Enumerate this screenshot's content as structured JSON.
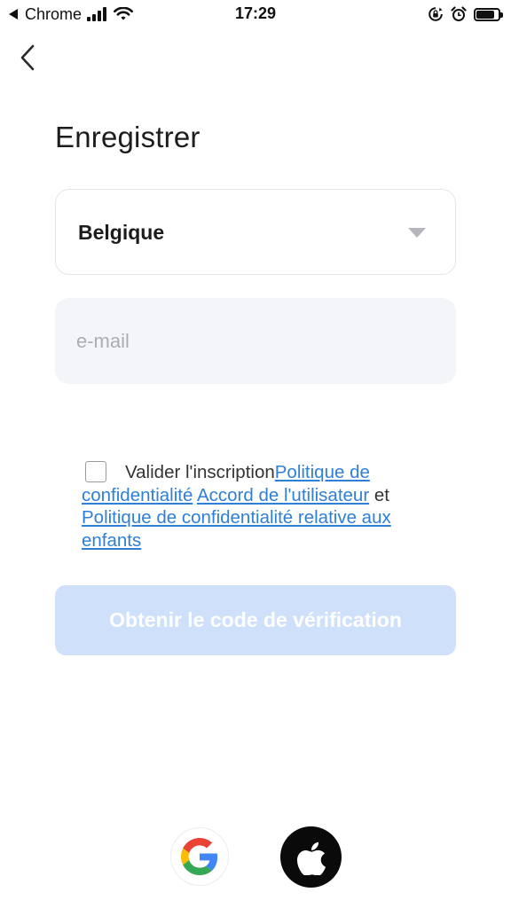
{
  "status_bar": {
    "back_app": "Chrome",
    "time": "17:29",
    "battery_level": 0.85
  },
  "header": {
    "back_icon": "chevron-left-icon",
    "title": "Enregistrer"
  },
  "form": {
    "country_value": "Belgique",
    "email_placeholder": "e-mail",
    "email_value": ""
  },
  "consent": {
    "checked": false,
    "prefix": "Valider l'inscription",
    "privacy_link": "Politique de confidentialité",
    "terms_link": "Accord de l'utilisateur",
    "conjunction": "et",
    "children_privacy_link": "Politique de confidentialité relative aux enfants"
  },
  "actions": {
    "verify_label": "Obtenir le code de vérification"
  },
  "social": {
    "google_icon": "google-icon",
    "apple_icon": "apple-icon"
  },
  "colors": {
    "accent_link": "#2f7fd6",
    "button_disabled_bg": "#cfe1fa",
    "input_bg": "#f4f5f9"
  }
}
